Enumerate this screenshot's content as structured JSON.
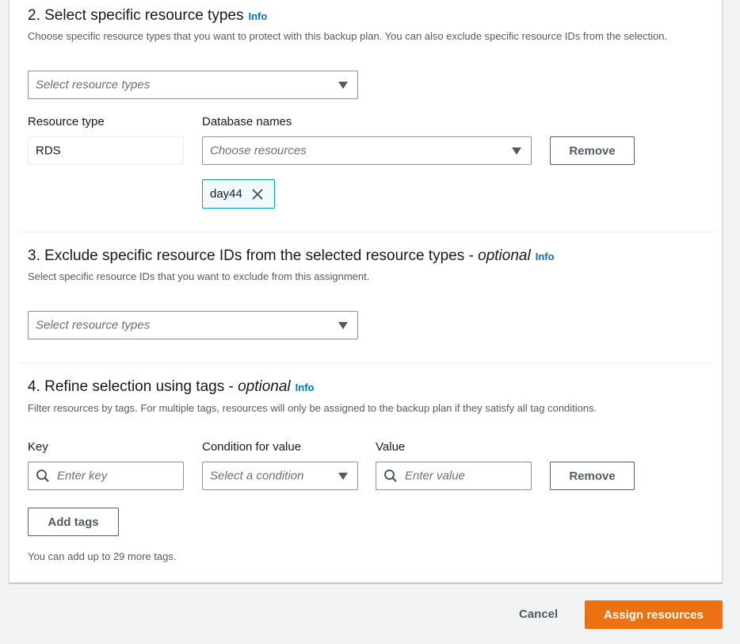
{
  "section2": {
    "title": "2. Select specific resource types",
    "info": "Info",
    "description": "Choose specific resource types that you want to protect with this backup plan. You can also exclude specific resource IDs from the selection.",
    "resource_select_placeholder": "Select resource types",
    "resource_type_label": "Resource type",
    "resource_type_value": "RDS",
    "database_names_label": "Database names",
    "choose_resources_placeholder": "Choose resources",
    "remove_label": "Remove",
    "token": "day44"
  },
  "section3": {
    "title": "3. Exclude specific resource IDs from the selected resource types - ",
    "optional": "optional",
    "info": "Info",
    "description": "Select specific resource IDs that you want to exclude from this assignment.",
    "resource_select_placeholder": "Select resource types"
  },
  "section4": {
    "title": "4. Refine selection using tags - ",
    "optional": "optional",
    "info": "Info",
    "description": "Filter resources by tags. For multiple tags, resources will only be assigned to the backup plan if they satisfy all tag conditions.",
    "key_label": "Key",
    "key_placeholder": "Enter key",
    "condition_label": "Condition for value",
    "condition_placeholder": "Select a condition",
    "value_label": "Value",
    "value_placeholder": "Enter value",
    "remove_label": "Remove",
    "add_tags_label": "Add tags",
    "note": "You can add up to 29 more tags."
  },
  "footer": {
    "cancel_label": "Cancel",
    "assign_label": "Assign resources"
  },
  "colors": {
    "accent": "#ec7211",
    "link": "#0073bb",
    "token_border": "#00a1c9"
  },
  "icons": [
    "caret-down-icon",
    "close-icon",
    "search-icon"
  ]
}
